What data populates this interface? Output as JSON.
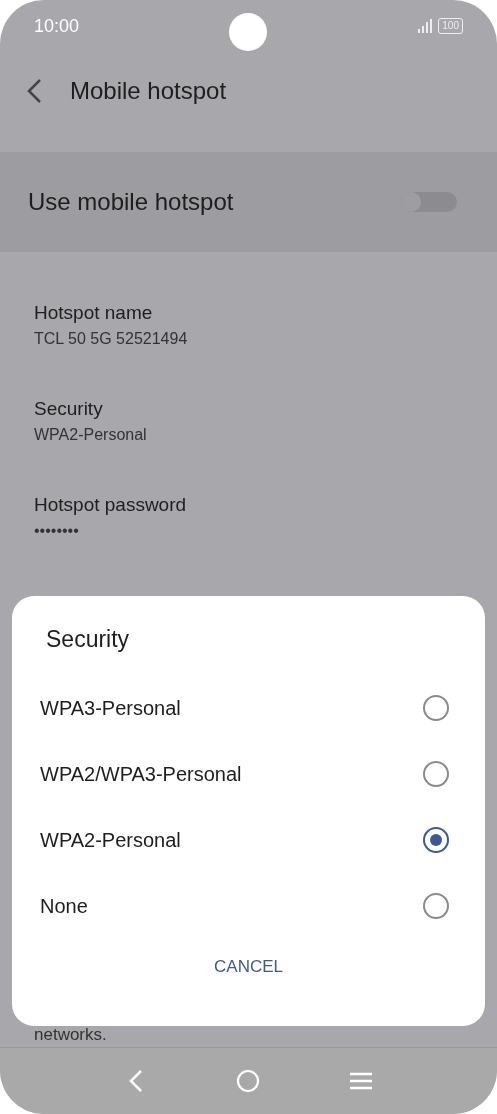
{
  "status_bar": {
    "time": "10:00",
    "battery": "100"
  },
  "header": {
    "title": "Mobile hotspot"
  },
  "master_switch": {
    "label": "Use mobile hotspot",
    "on": false
  },
  "settings": [
    {
      "label": "Hotspot name",
      "value": "TCL 50 5G 52521494"
    },
    {
      "label": "Security",
      "value": "WPA2-Personal"
    },
    {
      "label": "Hotspot password",
      "value": "••••••••"
    }
  ],
  "footer_note": "networks.",
  "dialog": {
    "title": "Security",
    "options": [
      {
        "label": "WPA3-Personal",
        "selected": false
      },
      {
        "label": "WPA2/WPA3-Personal",
        "selected": false
      },
      {
        "label": "WPA2-Personal",
        "selected": true
      },
      {
        "label": "None",
        "selected": false
      }
    ],
    "button": "CANCEL"
  }
}
